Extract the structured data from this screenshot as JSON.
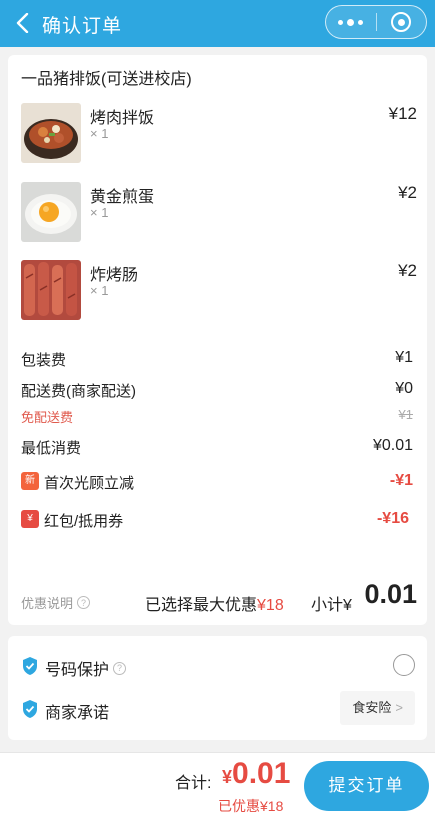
{
  "header": {
    "title": "确认订单",
    "back_icon": "chevron-left-icon",
    "menu_icon": "more-dots-icon",
    "close_icon": "target-close-icon"
  },
  "order": {
    "shop_name": "一品猪排饭(可送进校店)",
    "items": [
      {
        "name": "烤肉拌饭",
        "qty": "× 1",
        "price": "¥12"
      },
      {
        "name": "黄金煎蛋",
        "qty": "× 1",
        "price": "¥2"
      },
      {
        "name": "炸烤肠",
        "qty": "× 1",
        "price": "¥2"
      }
    ],
    "fees": {
      "packaging_label": "包装费",
      "packaging_value": "¥1",
      "delivery_label": "配送费(商家配送)",
      "delivery_value": "¥0",
      "free_delivery_label": "免配送费",
      "free_delivery_value": "¥1",
      "min_spend_label": "最低消费",
      "min_spend_value": "¥0.01"
    },
    "promos": {
      "first_badge": "新",
      "first_label": "首次光顾立减",
      "first_value": "-¥1",
      "coupon_badge": "¥",
      "coupon_label": "红包/抵用券",
      "coupon_value": "-¥16"
    },
    "summary": {
      "note_label": "优惠说明",
      "selected_prefix": "已选择最大优惠",
      "selected_value": "¥18",
      "subtotal_label": "小计¥",
      "subtotal_value": "0.01"
    }
  },
  "guarantees": {
    "privacy_label": "号码保护",
    "promise_label": "商家承诺",
    "promise_tag": "食安险",
    "tag_chevron": ">"
  },
  "footer": {
    "total_label": "合计:",
    "currency": "¥",
    "total_value": "0.01",
    "saved_text": "已优惠¥18",
    "submit_label": "提交订单"
  },
  "colors": {
    "primary": "#2ea7e0",
    "accent_red": "#e64b42"
  }
}
